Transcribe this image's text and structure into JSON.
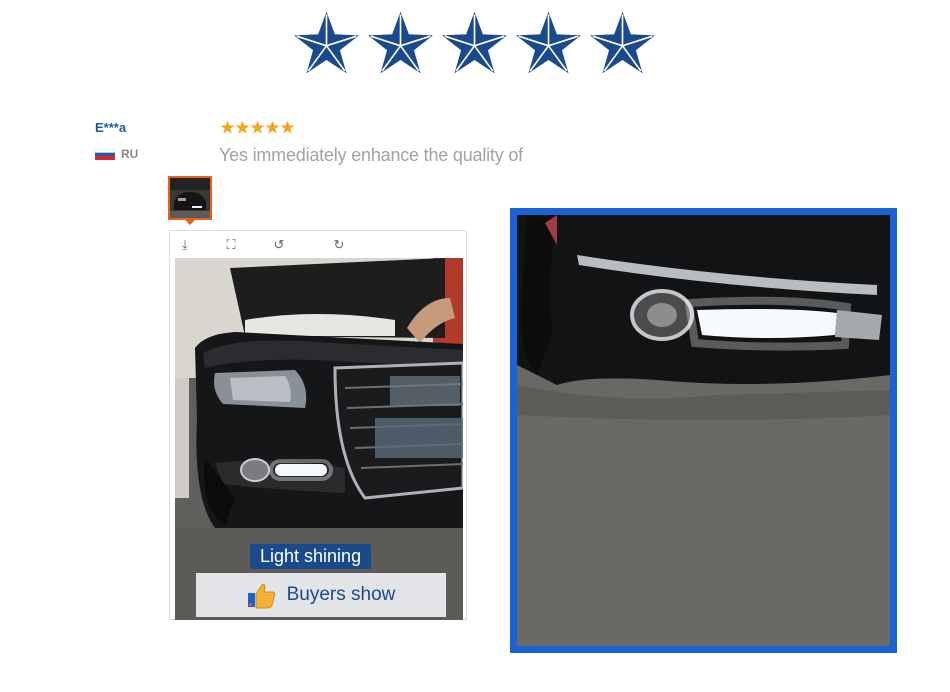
{
  "rating": {
    "stars": 5,
    "max": 5,
    "star_icon": "star-icon",
    "color": "#1a4a8c"
  },
  "review": {
    "reviewer_name": "E***a",
    "country_code": "RU",
    "flag_icon": "russia-flag-icon",
    "stars": 5,
    "star_color": "#f5a623",
    "text": "Yes immediately enhance the quality of"
  },
  "viewer": {
    "tools": [
      {
        "icon": "download-icon",
        "glyph": "⤓"
      },
      {
        "icon": "fullscreen-icon",
        "glyph": "⛶"
      },
      {
        "icon": "rotate-left-icon",
        "glyph": "↺"
      },
      {
        "icon": "rotate-right-icon",
        "glyph": "↻"
      }
    ],
    "overlay_tag": "Light shining",
    "overlay_banner": "Buyers show",
    "banner_icon": "thumbs-up-icon"
  },
  "colors": {
    "accent_blue": "#1a63d6",
    "thumb_border": "#e4621c"
  }
}
